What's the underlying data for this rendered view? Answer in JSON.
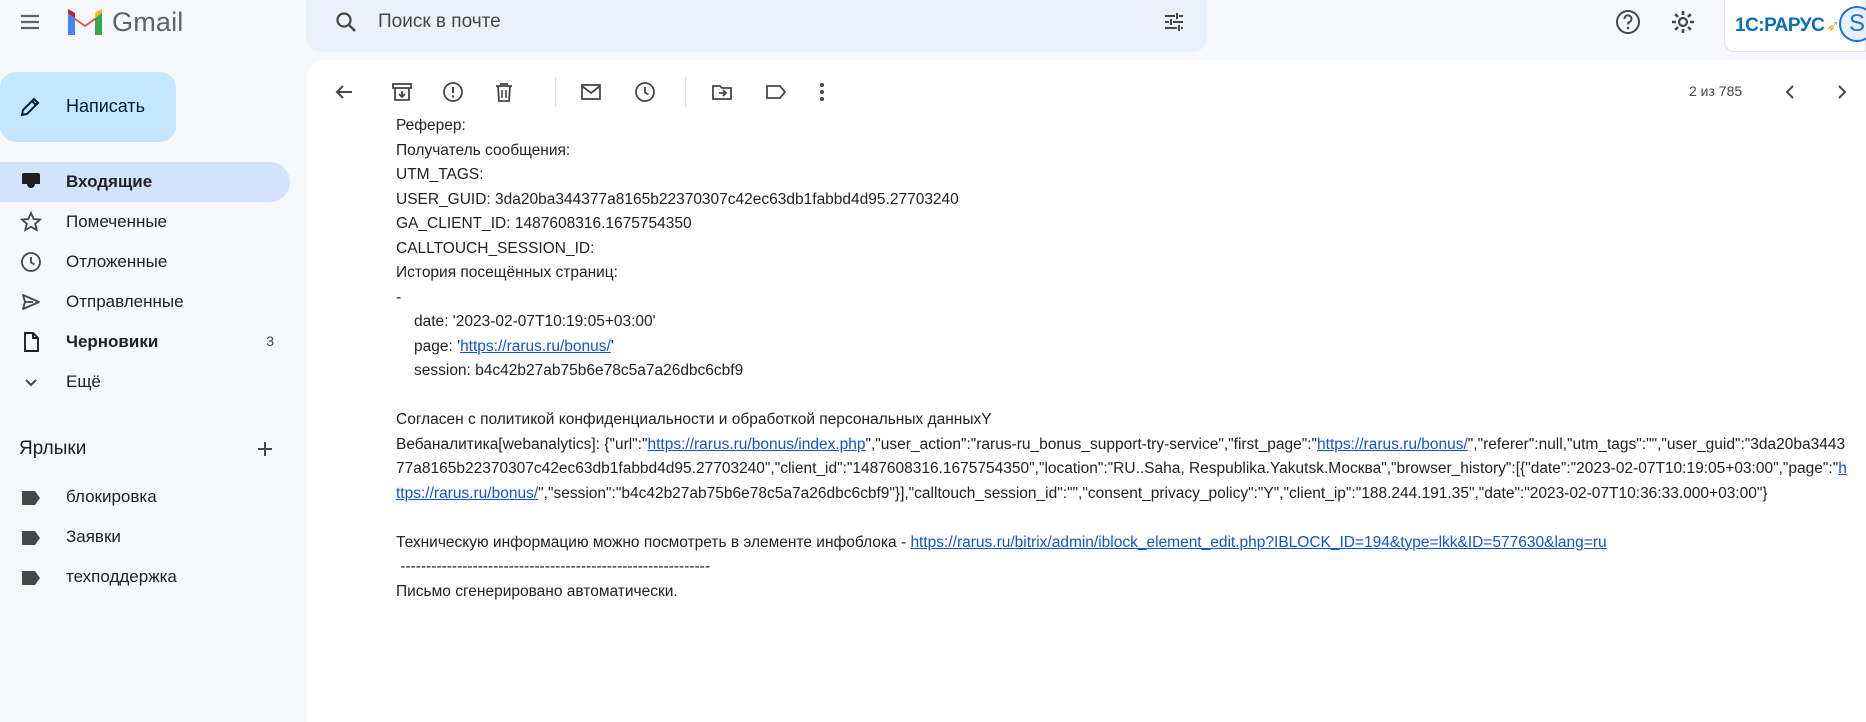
{
  "app": {
    "name": "Gmail"
  },
  "search": {
    "placeholder": "Поиск в почте"
  },
  "brand": {
    "text": "1С:РАРУС",
    "avatar_letter": "S"
  },
  "compose": {
    "label": "Написать"
  },
  "nav": {
    "items": [
      {
        "label": "Входящие",
        "icon": "inbox-icon",
        "active": true
      },
      {
        "label": "Помеченные",
        "icon": "star-icon"
      },
      {
        "label": "Отложенные",
        "icon": "clock-icon"
      },
      {
        "label": "Отправленные",
        "icon": "send-icon"
      },
      {
        "label": "Черновики",
        "icon": "draft-icon",
        "count": "3"
      },
      {
        "label": "Ещё",
        "icon": "chevron-down-icon"
      }
    ]
  },
  "labels": {
    "title": "Ярлыки",
    "items": [
      {
        "label": "блокировка"
      },
      {
        "label": "Заявки"
      },
      {
        "label": "техподдержка"
      }
    ]
  },
  "toolbar": {
    "pager": "2 из 785"
  },
  "email": {
    "referer": "Реферер:",
    "recipient": "Получатель сообщения:",
    "utm": "UTM_TAGS:",
    "user_guid": "USER_GUID: 3da20ba344377a8165b22370307c42ec63db1fabbd4d95.27703240",
    "ga_client": "GA_CLIENT_ID: 1487608316.1675754350",
    "calltouch": "CALLTOUCH_SESSION_ID:",
    "history_title": "История посещённых страниц:",
    "dash": "-",
    "date_line": "date: '2023-02-07T10:19:05+03:00'",
    "page_prefix": "page: '",
    "page_link": "https://rarus.ru/bonus/",
    "page_suffix": "'",
    "session_line": "session: b4c42b27ab75b6e78c5a7a26dbc6cbf9",
    "consent": "Согласен с политикой конфиденциальности и обработкой персональных данныхY",
    "webanalytics_1": "Вебаналитика[webanalytics]: {\"url\":\"",
    "webanalytics_link1": "https://rarus.ru/bonus/index.php",
    "webanalytics_2": "\",\"user_action\":\"rarus-ru_bonus_support-try-service\",\"first_page\":\"",
    "webanalytics_link2": "https://rarus.ru/bonus/",
    "webanalytics_3": "\",\"referer\":null,\"utm_tags\":\"\",\"user_guid\":\"3da20ba344377a8165b22370307c42ec63db1fabbd4d95.27703240\",\"client_id\":\"1487608316.1675754350\",\"location\":\"RU..Saha, Respublika.Yakutsk.Москва\",\"browser_history\":[{\"date\":\"2023-02-07T10:19:05+03:00\",\"page\":\"",
    "webanalytics_link3": "https://rarus.ru/bonus/",
    "webanalytics_4": "\",\"session\":\"b4c42b27ab75b6e78c5a7a26dbc6cbf9\"}],\"calltouch_session_id\":\"\",\"consent_privacy_policy\":\"Y\",\"client_ip\":\"188.244.191.35\",\"date\":\"2023-02-07T10:36:33.000+03:00\"}",
    "tech_prefix": "Техническую информацию можно посмотреть в элементе инфоблока - ",
    "tech_link": "https://rarus.ru/bitrix/admin/iblock_element_edit.php?IBLOCK_ID=194&type=lkk&ID=577630&lang=ru",
    "divider": " ------------------------------------------------------------",
    "auto": "Письмо сгенерировано автоматически."
  }
}
